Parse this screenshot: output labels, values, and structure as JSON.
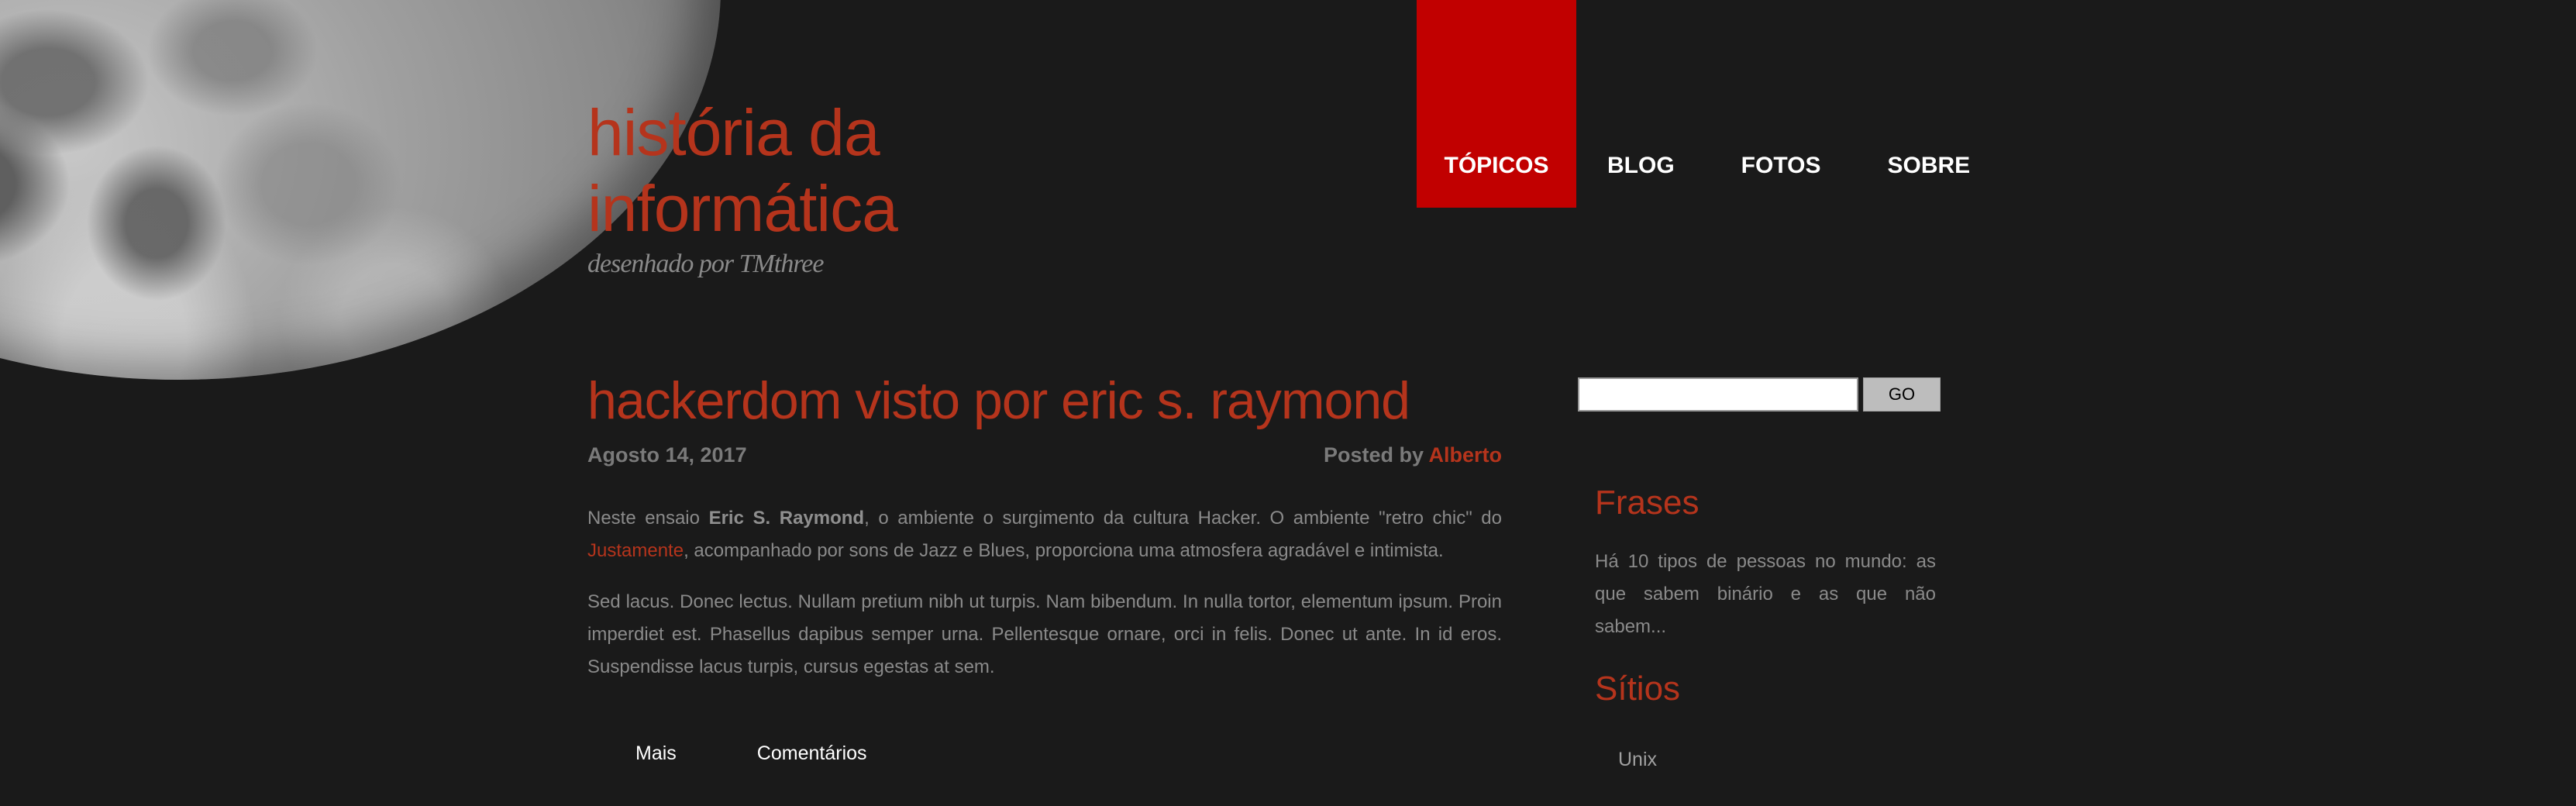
{
  "header": {
    "title": "história da informática",
    "subtitle": "desenhado por TMthree"
  },
  "nav": {
    "items": [
      {
        "label": "TÓPICOS",
        "active": true
      },
      {
        "label": "BLOG",
        "active": false
      },
      {
        "label": "FOTOS",
        "active": false
      },
      {
        "label": "SOBRE",
        "active": false
      }
    ]
  },
  "post": {
    "title": "hackerdom visto por eric s. raymond",
    "date": "Agosto 14, 2017",
    "posted_by_label": "Posted by",
    "author": "Alberto",
    "p1_before": "Neste ensaio ",
    "p1_bold": "Eric S. Raymond",
    "p1_middle": ", o ambiente o surgimento da cultura Hacker. O ambiente \"retro chic\" do ",
    "p1_link": "Justamente",
    "p1_after": ", acompanhado por sons de Jazz e Blues, proporciona uma atmosfera agradável e intimista.",
    "p2": "Sed lacus. Donec lectus. Nullam pretium nibh ut turpis. Nam bibendum. In nulla tortor, elementum ipsum. Proin imperdiet est. Phasellus dapibus semper urna. Pellentesque ornare, orci in felis. Donec ut ante. In id eros. Suspendisse lacus turpis, cursus egestas at sem.",
    "more_label": "Mais",
    "comments_label": "Comentários"
  },
  "sidebar": {
    "search_value": "",
    "go_label": "GO",
    "frases_heading": "Frases",
    "frases_text": "Há 10 tipos de pessoas no mundo: as que sabem binário e as que não sabem...",
    "sitios_heading": "Sítios",
    "sitios_links": [
      "Unix"
    ]
  },
  "colors": {
    "background": "#1a1a1a",
    "accent": "#b5341c",
    "nav_active": "#c10000",
    "text": "#8a8a8a"
  }
}
